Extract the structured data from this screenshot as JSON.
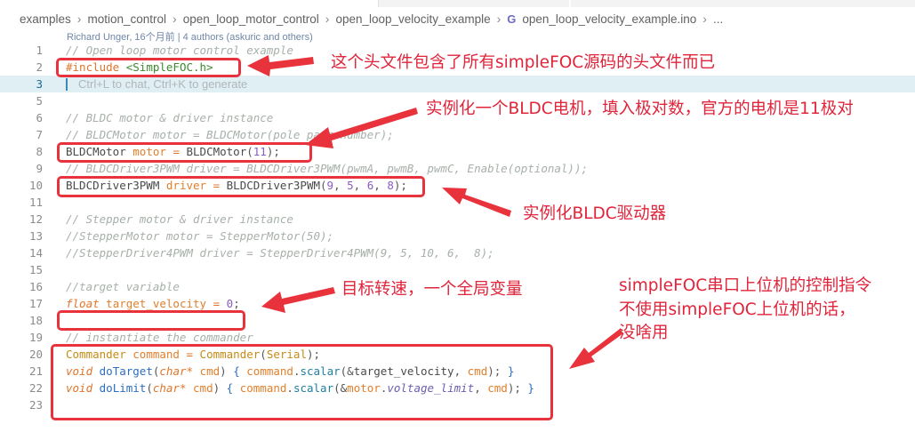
{
  "breadcrumb": {
    "items": [
      "examples",
      "motion_control",
      "open_loop_motor_control",
      "open_loop_velocity_example"
    ],
    "file_icon": "G",
    "file": "open_loop_velocity_example.ino",
    "more": "..."
  },
  "blame": "Richard Unger, 16个月前 | 4 authors (askuric and others)",
  "editor": {
    "line_numbers": [
      "1",
      "2",
      "3",
      "5",
      "6",
      "7",
      "8",
      "9",
      "10",
      "11",
      "12",
      "13",
      "14",
      "15",
      "16",
      "17",
      "18",
      "19",
      "20",
      "21",
      "22",
      "23"
    ],
    "inline_hint": "Ctrl+L to chat, Ctrl+K to generate",
    "code": {
      "l1": [
        "// Open loop motor control example"
      ],
      "l2": [
        "#include",
        " ",
        "<SimpleFOC.h>"
      ],
      "l5": [
        "// BLDC motor & driver instance"
      ],
      "l6": [
        "// BLDCMotor motor = BLDCMotor(pole pair number);"
      ],
      "l7": [
        "BLDCMotor",
        " ",
        "motor",
        " ",
        "=",
        " ",
        "BLDCMotor",
        "(",
        "11",
        ");"
      ],
      "l8": [
        "// BLDCDriver3PWM driver = BLDCDriver3PWM(pwmA, pwmB, pwmC, Enable(optional));"
      ],
      "l9": [
        "BLDCDriver3PWM",
        " ",
        "driver",
        " ",
        "=",
        " ",
        "BLDCDriver3PWM",
        "(",
        "9",
        ", ",
        "5",
        ", ",
        "6",
        ", ",
        "8",
        ");"
      ],
      "l12": [
        "// Stepper motor & driver instance"
      ],
      "l13": [
        "//StepperMotor motor = StepperMotor(50);"
      ],
      "l14": [
        "//StepperDriver4PWM driver = StepperDriver4PWM(9, 5, 10, 6,  8);"
      ],
      "l16": [
        "//target variable"
      ],
      "l17": [
        "float",
        " ",
        "target_velocity",
        " ",
        "=",
        " ",
        "0",
        ";"
      ],
      "l20": [
        "// instantiate the commander"
      ],
      "l21": [
        "Commander",
        " ",
        "command",
        " ",
        "=",
        " ",
        "Commander",
        "(",
        "Serial",
        ");"
      ],
      "l22": [
        "void",
        " ",
        "doTarget",
        "(",
        "char*",
        " ",
        "cmd",
        ") ",
        "{",
        " ",
        "command",
        ".",
        "scalar",
        "(&",
        "target_velocity",
        ", ",
        "cmd",
        "); ",
        "}"
      ],
      "l23": [
        "void",
        " ",
        "doLimit",
        "(",
        "char*",
        " ",
        "cmd",
        ") ",
        "{",
        " ",
        "command",
        ".",
        "scalar",
        "(&",
        "motor",
        ".",
        "voltage_limit",
        ", ",
        "cmd",
        "); ",
        "}"
      ]
    }
  },
  "annotations": {
    "include_note": "这个头文件包含了所有simpleFOC源码的头文件而已",
    "motor_note": "实例化一个BLDC电机，填入极对数，官方的电机是11极对",
    "driver_note": "实例化BLDC驱动器",
    "target_note": "目标转速，一个全局变量",
    "commander_note_1": "simpleFOC串口上位机的控制指令",
    "commander_note_2": "不使用simpleFOC上位机的话，",
    "commander_note_3": "没啥用"
  },
  "colors": {
    "annotation": "#e8323c",
    "comment": "#a7b0a9",
    "keyword": "#e0752b",
    "string": "#3b8b2c",
    "number": "#8a5cc4",
    "function": "#2c6ec0",
    "current_line": "#dfeff4"
  },
  "icons": [
    "chevron-right-icon",
    "file-type-icon",
    "annotation-arrow-icon"
  ]
}
